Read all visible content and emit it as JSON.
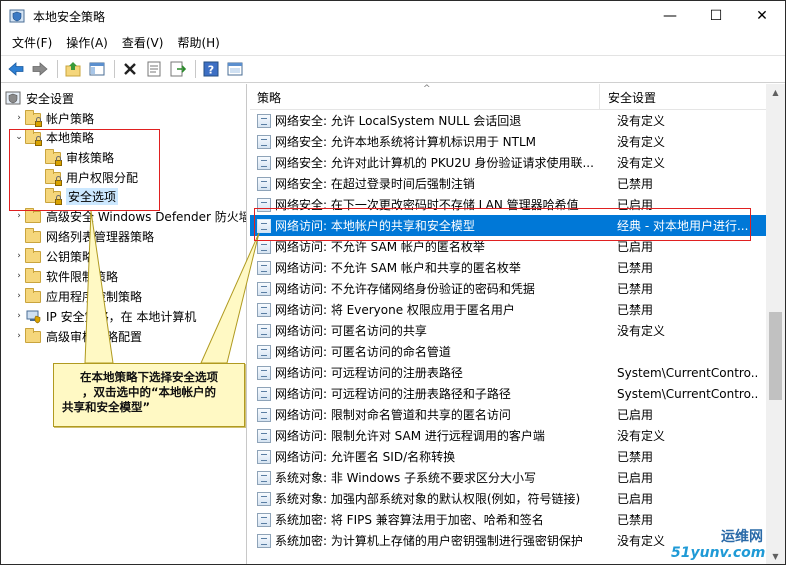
{
  "window": {
    "title": "本地安全策略",
    "controls": {
      "minimize": "—",
      "maximize": "☐",
      "close": "✕"
    }
  },
  "menu": [
    "文件(F)",
    "操作(A)",
    "查看(V)",
    "帮助(H)"
  ],
  "toolbar": {
    "icons": [
      "back-icon",
      "forward-icon",
      "up-folder-icon",
      "show-hide-tree-icon",
      "delete-icon",
      "properties-icon",
      "export-list-icon",
      "help-icon",
      "console-view-icon"
    ]
  },
  "tree": {
    "items": [
      {
        "label": "安全设置",
        "level": 0,
        "icon": "security-settings-icon"
      },
      {
        "label": "帐户策略",
        "level": 1,
        "icon": "locked-folder-icon",
        "expander": "›"
      },
      {
        "label": "本地策略",
        "level": 1,
        "icon": "locked-folder-icon",
        "expander": "⌄"
      },
      {
        "label": "审核策略",
        "level": 2,
        "icon": "locked-folder-icon"
      },
      {
        "label": "用户权限分配",
        "level": 2,
        "icon": "locked-folder-icon"
      },
      {
        "label": "安全选项",
        "level": 2,
        "icon": "locked-folder-icon",
        "selected": true
      },
      {
        "label": "高级安全 Windows Defender 防火墙",
        "level": 1,
        "icon": "folder-icon",
        "expander": "›"
      },
      {
        "label": "网络列表管理器策略",
        "level": 1,
        "icon": "folder-icon"
      },
      {
        "label": "公钥策略",
        "level": 1,
        "icon": "folder-icon",
        "expander": "›"
      },
      {
        "label": "软件限制策略",
        "level": 1,
        "icon": "folder-icon",
        "expander": "›"
      },
      {
        "label": "应用程序控制策略",
        "level": 1,
        "icon": "folder-icon",
        "expander": "›"
      },
      {
        "label": "IP 安全策略，在 本地计算机",
        "level": 1,
        "icon": "ip-security-icon",
        "expander": "›"
      },
      {
        "label": "高级审核策略配置",
        "level": 1,
        "icon": "folder-icon",
        "expander": "›"
      }
    ]
  },
  "list": {
    "columns": [
      "策略",
      "安全设置"
    ],
    "rows": [
      {
        "policy": "网络安全: 允许 LocalSystem NULL 会话回退",
        "setting": "没有定义"
      },
      {
        "policy": "网络安全: 允许本地系统将计算机标识用于 NTLM",
        "setting": "没有定义"
      },
      {
        "policy": "网络安全: 允许对此计算机的 PKU2U 身份验证请求使用联...",
        "setting": "没有定义"
      },
      {
        "policy": "网络安全: 在超过登录时间后强制注销",
        "setting": "已禁用"
      },
      {
        "policy": "网络安全: 在下一次更改密码时不存储 LAN 管理器哈希值",
        "setting": "已启用"
      },
      {
        "policy": "网络访问: 本地帐户的共享和安全模型",
        "setting": "经典 - 对本地用户进行...",
        "selected": true
      },
      {
        "policy": "网络访问: 不允许 SAM 帐户的匿名枚举",
        "setting": "已启用"
      },
      {
        "policy": "网络访问: 不允许 SAM 帐户和共享的匿名枚举",
        "setting": "已禁用"
      },
      {
        "policy": "网络访问: 不允许存储网络身份验证的密码和凭据",
        "setting": "已禁用"
      },
      {
        "policy": "网络访问: 将 Everyone 权限应用于匿名用户",
        "setting": "已禁用"
      },
      {
        "policy": "网络访问: 可匿名访问的共享",
        "setting": "没有定义"
      },
      {
        "policy": "网络访问: 可匿名访问的命名管道",
        "setting": ""
      },
      {
        "policy": "网络访问: 可远程访问的注册表路径",
        "setting": "System\\CurrentContro..."
      },
      {
        "policy": "网络访问: 可远程访问的注册表路径和子路径",
        "setting": "System\\CurrentContro..."
      },
      {
        "policy": "网络访问: 限制对命名管道和共享的匿名访问",
        "setting": "已启用"
      },
      {
        "policy": "网络访问: 限制允许对 SAM 进行远程调用的客户端",
        "setting": "没有定义"
      },
      {
        "policy": "网络访问: 允许匿名 SID/名称转换",
        "setting": "已禁用"
      },
      {
        "policy": "系统对象: 非 Windows 子系统不要求区分大小写",
        "setting": "已启用"
      },
      {
        "policy": "系统对象: 加强内部系统对象的默认权限(例如，符号链接)",
        "setting": "已启用"
      },
      {
        "policy": "系统加密: 将 FIPS 兼容算法用于加密、哈希和签名",
        "setting": "已禁用"
      },
      {
        "policy": "系统加密: 为计算机上存储的用户密钥强制进行强密钥保护",
        "setting": "没有定义"
      }
    ]
  },
  "callout": {
    "line1": "在本地策略下选择安全选项",
    "line2": "，双击选中的“本地帐户的",
    "line3": "共享和安全模型”"
  },
  "watermark": {
    "top": "运维网",
    "bottom": "51yunv.com"
  },
  "colors": {
    "selection": "#0078d7",
    "annotation": "#e02020",
    "callout_bg": "#fff9c4"
  }
}
